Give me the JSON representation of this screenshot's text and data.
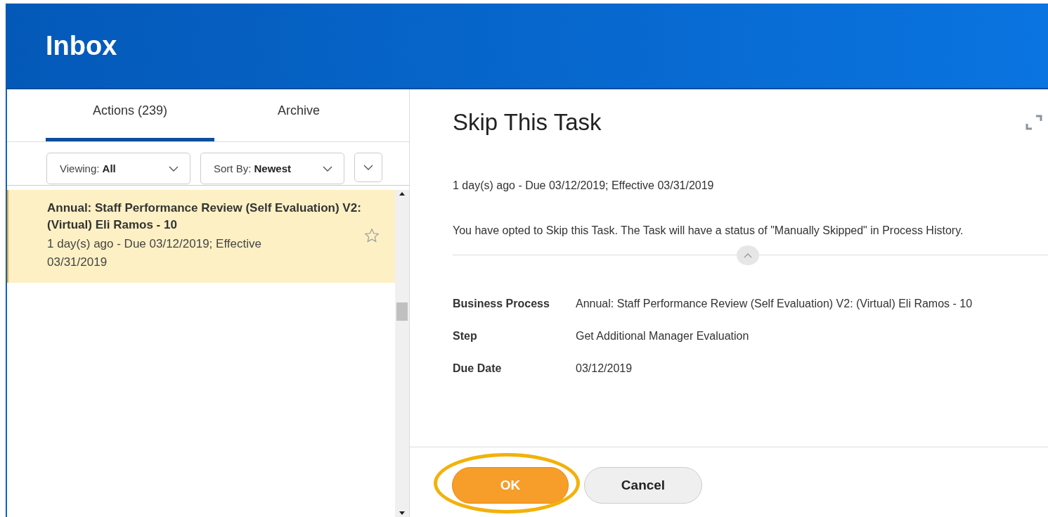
{
  "header": {
    "title": "Inbox"
  },
  "tabs": [
    {
      "label": "Actions (239)",
      "selected": true
    },
    {
      "label": "Archive",
      "selected": false
    }
  ],
  "filters": [
    {
      "label": "Viewing:",
      "value": "All"
    },
    {
      "label": "Sort By:",
      "value": "Newest"
    }
  ],
  "inbox_items": [
    {
      "title": "Annual: Staff Performance Review (Self Evaluation) V2: (Virtual) Eli Ramos - 10",
      "subtitle": "1 day(s) ago - Due 03/12/2019; Effective 03/31/2019",
      "selected": true,
      "starred": false
    }
  ],
  "detail": {
    "title": "Skip This Task",
    "meta": "1 day(s) ago - Due 03/12/2019; Effective 03/31/2019",
    "message": "You have opted to Skip this Task. The Task will have a status of \"Manually Skipped\" in Process History.",
    "fields": [
      {
        "label": "Business Process",
        "value": "Annual: Staff Performance Review (Self Evaluation) V2: (Virtual) Eli Ramos - 10"
      },
      {
        "label": "Step",
        "value": "Get Additional Manager Evaluation"
      },
      {
        "label": "Due Date",
        "value": "03/12/2019"
      }
    ]
  },
  "buttons": [
    {
      "label": "OK",
      "kind": "primary",
      "highlighted": true
    },
    {
      "label": "Cancel",
      "kind": "secondary",
      "highlighted": false
    }
  ]
}
